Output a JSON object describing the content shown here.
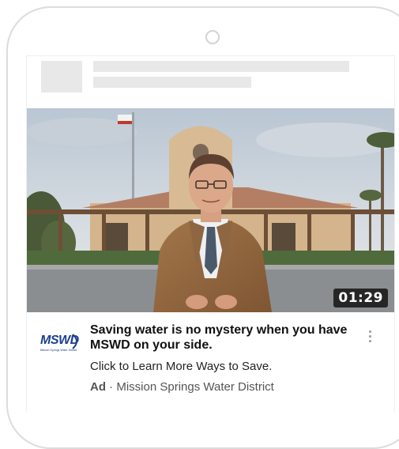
{
  "video": {
    "duration": "01:29"
  },
  "ad": {
    "logo_text": "MSWD",
    "logo_subtext": "Mission Springs Water District",
    "title": "Saving water is no mystery when you have MSWD on your side.",
    "description": "Click to Learn More Ways to Save.",
    "ad_label": "Ad",
    "separator": " · ",
    "advertiser": "Mission Springs Water District"
  },
  "colors": {
    "brand_blue": "#1c3f91",
    "placeholder_gray": "#e8e8e8"
  },
  "icons": {
    "menu": "more-vert-icon"
  }
}
